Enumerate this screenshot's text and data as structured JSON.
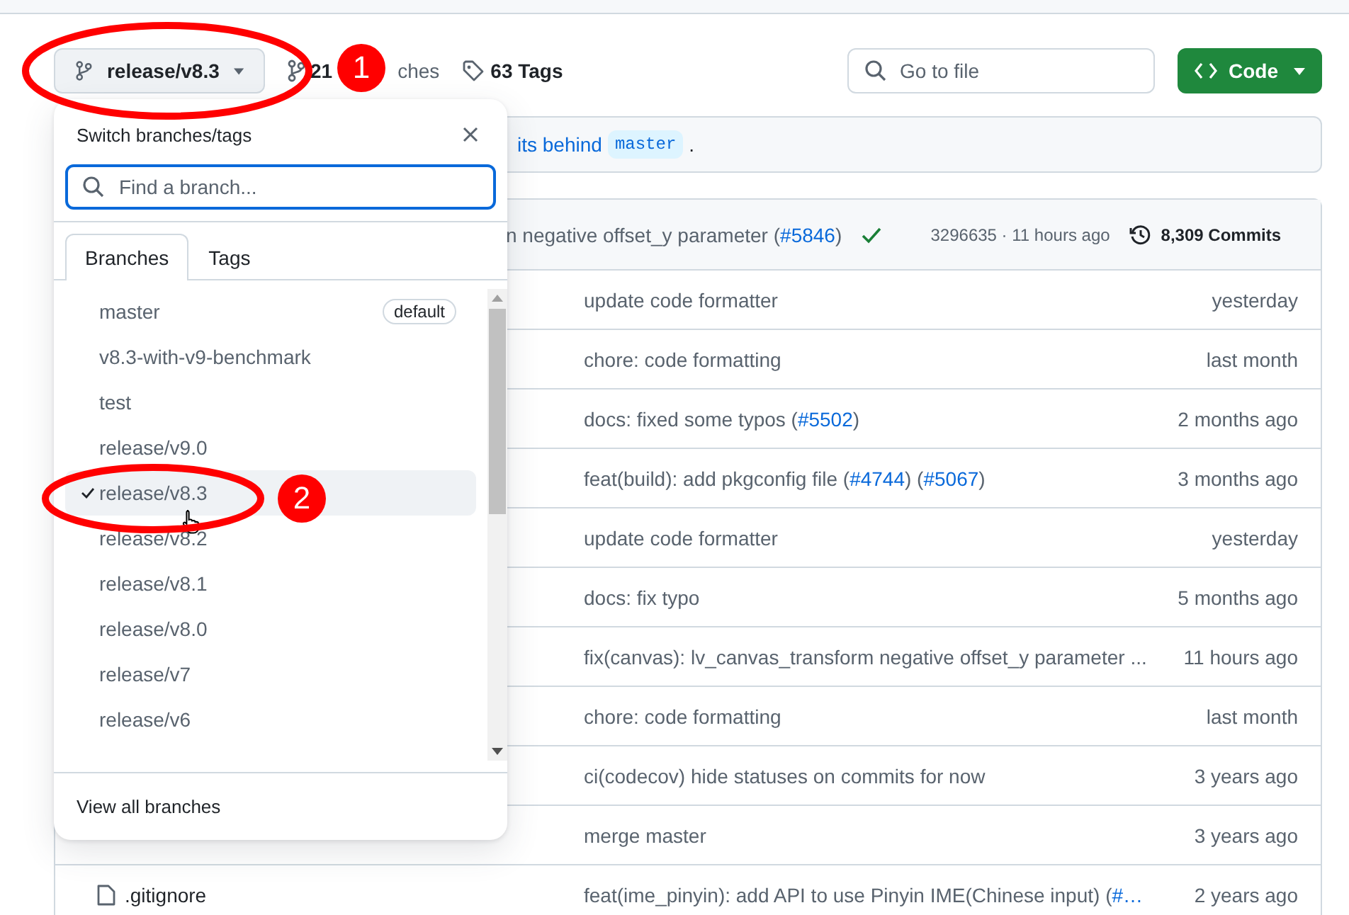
{
  "toolbar": {
    "branch_button": "release/v8.3",
    "branches_count": "21",
    "branches_label": "ches",
    "tags": "63 Tags",
    "search": {
      "placeholder": "Go to file"
    },
    "code_button": "Code"
  },
  "banner": {
    "text": "its behind",
    "branch": "master",
    "end": "."
  },
  "latest_commit": {
    "message": [
      {
        "t": "n negative offset_y parameter ("
      },
      {
        "t": "#5846",
        "kind": "link"
      },
      {
        "t": ")"
      }
    ],
    "checks_passed": true,
    "meta": "3296635 · 11 hours ago",
    "commits": "8,309 Commits"
  },
  "files": [
    {
      "message": [
        {
          "t": "update code formatter"
        }
      ],
      "time": "yesterday"
    },
    {
      "message": [
        {
          "t": "chore: code formatting"
        }
      ],
      "time": "last month"
    },
    {
      "message": [
        {
          "t": "docs: fixed some typos ("
        },
        {
          "t": "#5502",
          "kind": "link"
        },
        {
          "t": ")"
        }
      ],
      "time": "2 months ago"
    },
    {
      "message": [
        {
          "t": "feat(build): add pkgconfig file ("
        },
        {
          "t": "#4744",
          "kind": "link"
        },
        {
          "t": ") ("
        },
        {
          "t": "#5067",
          "kind": "link"
        },
        {
          "t": ")"
        }
      ],
      "time": "3 months ago"
    },
    {
      "message": [
        {
          "t": "update code formatter"
        }
      ],
      "time": "yesterday"
    },
    {
      "message": [
        {
          "t": "docs: fix typo"
        }
      ],
      "time": "5 months ago"
    },
    {
      "message": [
        {
          "t": "fix(canvas): lv_canvas_transform negative offset_y parameter ..."
        }
      ],
      "time": "11 hours ago"
    },
    {
      "message": [
        {
          "t": "chore: code formatting"
        }
      ],
      "time": "last month"
    },
    {
      "message": [
        {
          "t": "ci(codecov) hide statuses on commits for now"
        }
      ],
      "time": "3 years ago"
    },
    {
      "message": [
        {
          "t": "merge master"
        }
      ],
      "time": "3 years ago"
    },
    {
      "name": ".gitignore",
      "kind": "file",
      "message": [
        {
          "t": "feat(ime_pinyin): add API to use Pinyin IME(Chinese input) ("
        },
        {
          "t": "#…",
          "kind": "link"
        }
      ],
      "time": "2 years ago"
    }
  ],
  "dropdown": {
    "title": "Switch branches/tags",
    "search": {
      "placeholder": "Find a branch..."
    },
    "tabs": [
      {
        "label": "Branches",
        "selected": true
      },
      {
        "label": "Tags",
        "selected": false
      }
    ],
    "branches": [
      {
        "name": "master",
        "badge": "default",
        "selected": false
      },
      {
        "name": "v8.3-with-v9-benchmark",
        "selected": false
      },
      {
        "name": "test",
        "selected": false
      },
      {
        "name": "release/v9.0",
        "selected": false
      },
      {
        "name": "release/v8.3",
        "selected": true
      },
      {
        "name": "release/v8.2",
        "selected": false
      },
      {
        "name": "release/v8.1",
        "selected": false
      },
      {
        "name": "release/v8.0",
        "selected": false
      },
      {
        "name": "release/v7",
        "selected": false
      },
      {
        "name": "release/v6",
        "selected": false
      }
    ],
    "footer": "View all branches"
  },
  "annotations": [
    "1",
    "2"
  ]
}
